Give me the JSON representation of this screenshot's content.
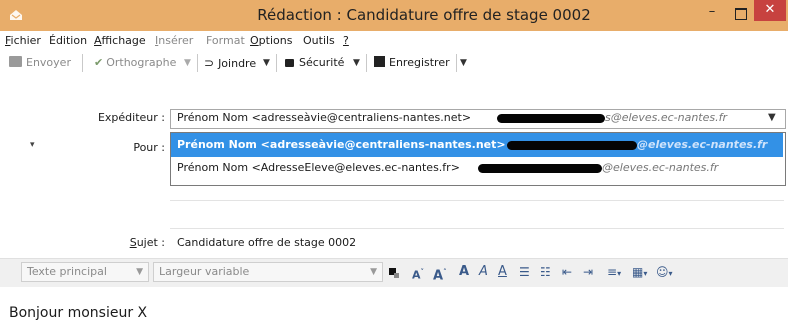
{
  "window": {
    "title": "Rédaction : Candidature offre de stage 0002",
    "minimize_glyph": "–",
    "close_glyph": "✕"
  },
  "menu": {
    "items": [
      {
        "label": "Fichier",
        "accel": "F",
        "rest": "ichier",
        "enabled": true
      },
      {
        "label": "Édition",
        "accel": "",
        "rest": "Édition",
        "enabled": true
      },
      {
        "label": "Affichage",
        "accel": "A",
        "rest": "ffichage",
        "enabled": true
      },
      {
        "label": "Insérer",
        "accel": "I",
        "rest": "nsérer",
        "enabled": false
      },
      {
        "label": "Format",
        "accel": "m",
        "rest": "Format",
        "enabled": false
      },
      {
        "label": "Options",
        "accel": "O",
        "rest": "ptions",
        "enabled": true
      },
      {
        "label": "Outils",
        "accel": "u",
        "rest": "Outils",
        "enabled": true
      },
      {
        "label": "?",
        "accel": "?",
        "rest": "",
        "enabled": true
      }
    ]
  },
  "toolbar": {
    "send": "Envoyer",
    "spell": "Orthographe",
    "attach": "Joindre",
    "security": "Sécurité",
    "save": "Enregistrer"
  },
  "form": {
    "from_label": "Expéditeur :",
    "to_label": "Pour :",
    "subject_label": "Sujet :",
    "from_value": "Prénom Nom <adresseàvie@centraliens-nantes.net>",
    "from_suffix": "s@eleves.ec-nantes.fr",
    "subject_value": "Candidature offre de stage 0002"
  },
  "dropdown": {
    "options": [
      {
        "text": "Prénom Nom <adresseàvie@centraliens-nantes.net>",
        "suffix": "@eleves.ec-nantes.fr",
        "selected": true
      },
      {
        "text": "Prénom Nom <AdresseEleve@eleves.ec-nantes.fr>",
        "suffix": "@eleves.ec-nantes.fr",
        "selected": false
      }
    ]
  },
  "format_bar": {
    "paragraph_style": "Texte principal",
    "font": "Largeur variable"
  },
  "body": {
    "text": "Bonjour monsieur X"
  },
  "colors": {
    "titlebar": "#e8ad6a",
    "close": "#c7423f",
    "selection": "#3391e6"
  }
}
